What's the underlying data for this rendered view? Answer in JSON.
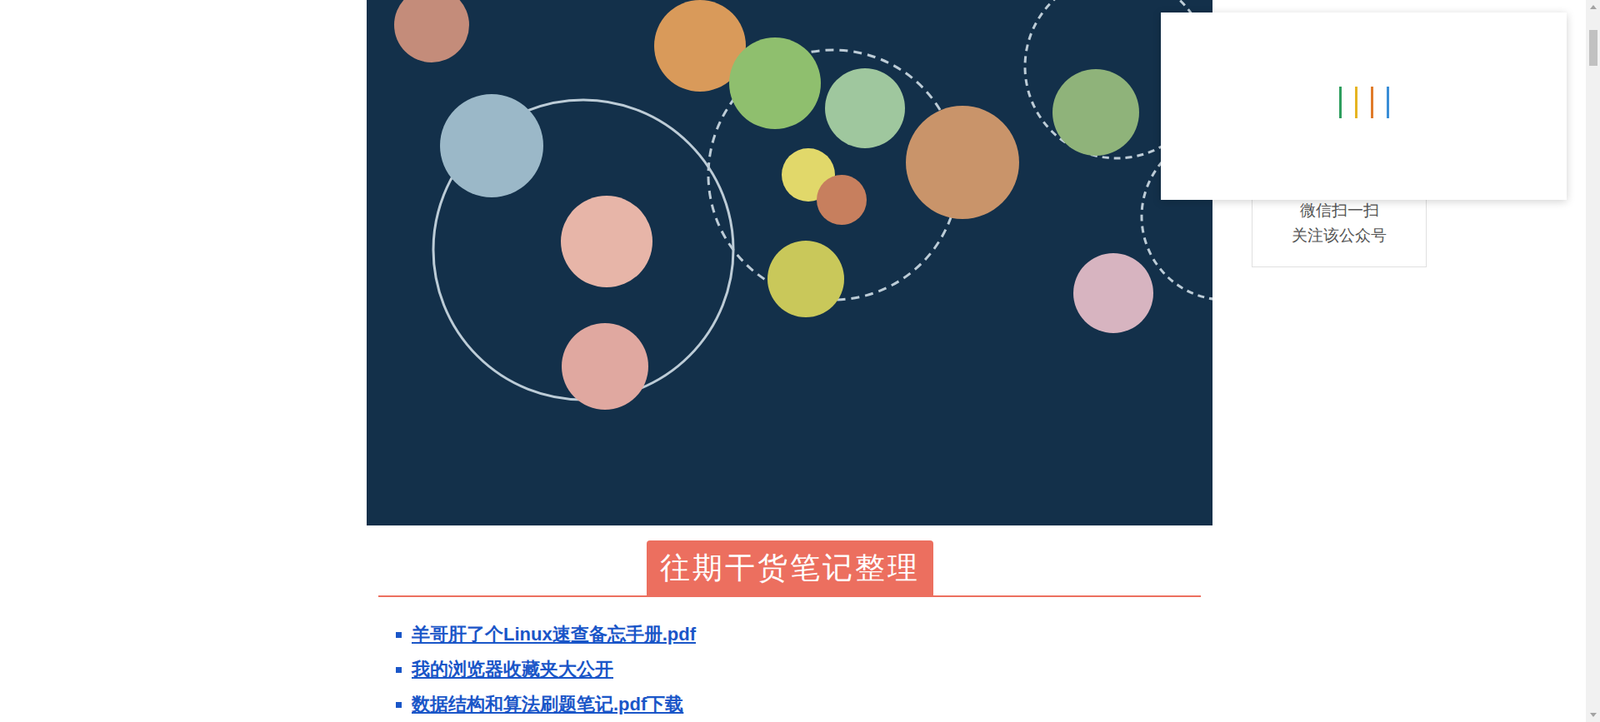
{
  "article": {
    "section_heading": "往期干货笔记整理",
    "links": [
      {
        "label": "羊哥肝了个Linux速查备忘手册.pdf"
      },
      {
        "label": "我的浏览器收藏夹大公开"
      },
      {
        "label": "数据结构和算法刷题笔记.pdf下载"
      }
    ]
  },
  "sidebar": {
    "qr_caption": [
      "微信扫一扫",
      "关注该公众号"
    ]
  },
  "loading_popup": {
    "bars": [
      {
        "color": "#2e9e5e"
      },
      {
        "color": "#e6b422"
      },
      {
        "color": "#e07b2a"
      },
      {
        "color": "#3a8ed6"
      }
    ]
  }
}
